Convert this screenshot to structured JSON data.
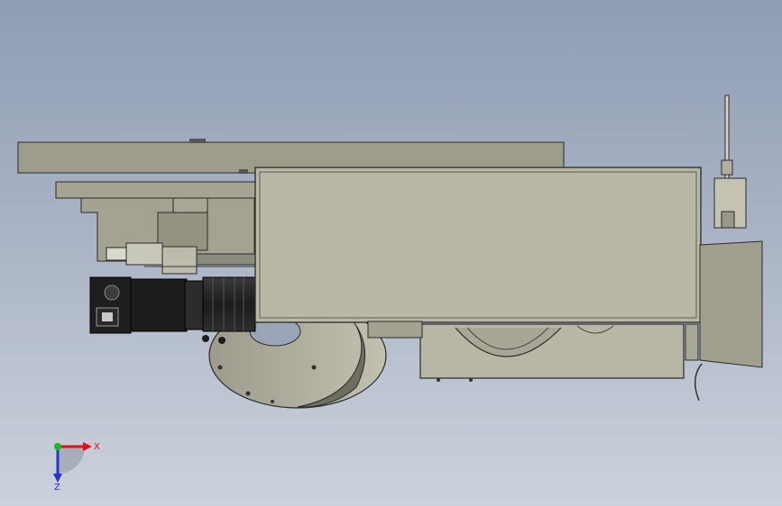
{
  "view": {
    "background_top": "#8f9cb3",
    "background_bottom": "#ccd2dc",
    "model_fill": "#b7b6a4",
    "model_edge": "#2a2a2a"
  },
  "triad": {
    "x_label": "X",
    "z_label": "Z",
    "x_color": "#e0101a",
    "y_color": "#18b818",
    "z_color": "#2034d0"
  },
  "icons": [
    "coordinate-triad-icon"
  ]
}
